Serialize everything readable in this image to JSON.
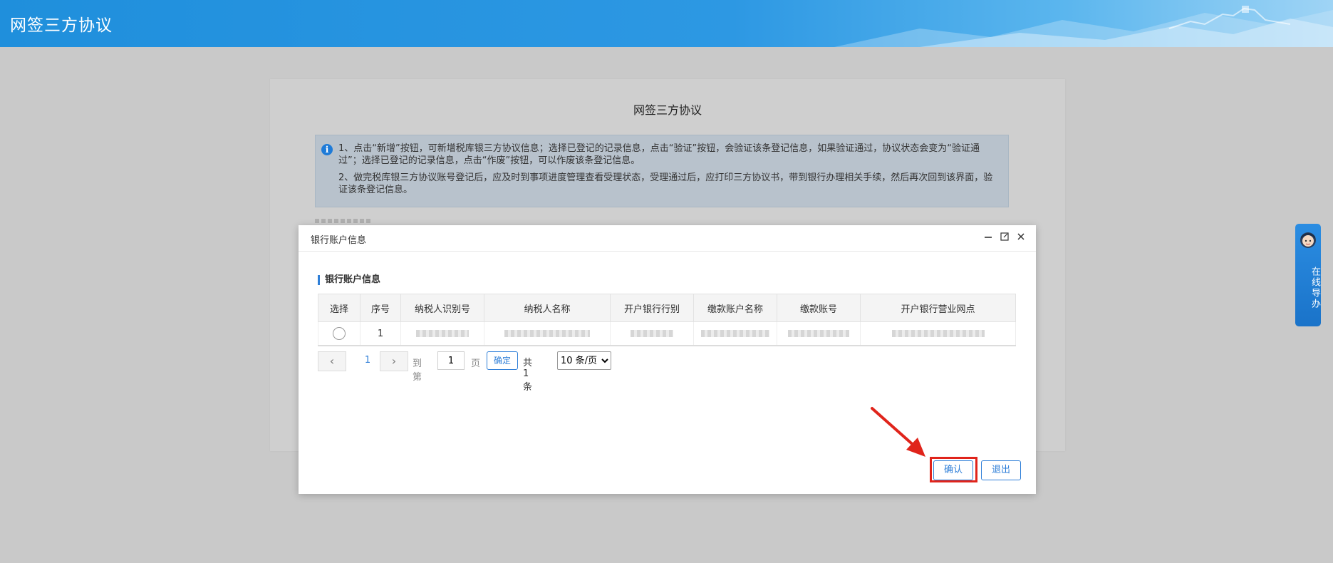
{
  "header": {
    "title": "网签三方协议"
  },
  "background": {
    "title": "网签三方协议",
    "notice_line1": "1、点击“新增”按钮，可新增税库银三方协议信息；选择已登记的记录信息，点击“验证”按钮，会验证该条登记信息，如果验证通过，协议状态会变为“验证通过”；选择已登记的记录信息，点击“作废”按钮，可以作废该条登记信息。",
    "notice_line2": "2、做完税库银三方协议账号登记后，应及时到事项进度管理查看受理状态，受理通过后，应打印三方协议书，带到银行办理相关手续，然后再次回到该界面，验证该条登记信息。"
  },
  "modal": {
    "title": "银行账户信息",
    "section_title": "银行账户信息",
    "table": {
      "columns": [
        "选择",
        "序号",
        "纳税人识别号",
        "纳税人名称",
        "开户银行行别",
        "缴款账户名称",
        "缴款账号",
        "开户银行营业网点"
      ],
      "rows": [
        {
          "index": "1"
        }
      ]
    },
    "pager": {
      "current_page": "1",
      "goto_label": "到第",
      "goto_value": "1",
      "page_label": "页",
      "confirm_label": "确定",
      "total_label": "共 1 条",
      "page_size": "10 条/页"
    },
    "buttons": {
      "confirm": "确认",
      "exit": "退出"
    }
  },
  "side_widget": {
    "label": "在线导办"
  },
  "colors": {
    "header_blue": "#2d98e3",
    "accent_blue": "#2f7fd8",
    "highlight_red": "#e0241b"
  }
}
